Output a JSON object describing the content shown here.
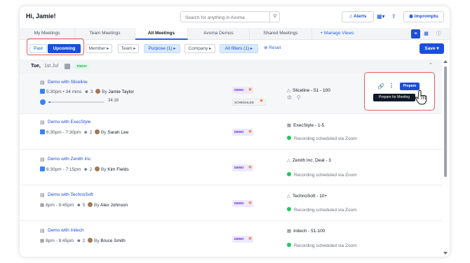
{
  "header": {
    "greeting": "Hi, Jamie!",
    "search_placeholder": "Search for anything in Avoma",
    "alerts_label": "Alerts",
    "impromptu_label": "Impromptu"
  },
  "tabs": [
    {
      "label": "My Meetings"
    },
    {
      "label": "Team Meetings"
    },
    {
      "label": "All Meetings",
      "active": true
    },
    {
      "label": "Avoma Demos"
    },
    {
      "label": "Shared Meetings"
    },
    {
      "label": "+ Manage Views"
    }
  ],
  "filters": {
    "past": "Past",
    "upcoming": "Upcoming",
    "member": "Member",
    "team": "Team",
    "purpose": "Purpose (1)",
    "company": "Company",
    "all_filters": "All filters (1)",
    "reset": "Reset",
    "save": "Save"
  },
  "date": {
    "day": "Tue,",
    "date": "1st Jul",
    "badge": "TODAY"
  },
  "meetings": [
    {
      "title": "Demo with Sliceline",
      "time": "5:30pm",
      "duration": "34 mins",
      "attendees": "3",
      "host": "Jamie Taylor",
      "progress": "34:18",
      "deal": "Sliceline - 51 - 100",
      "tag": "DEMO",
      "sched": "SCHEDULED"
    },
    {
      "title": "Demo with ExecStyle",
      "time": "6:30pm - 7:30pm",
      "attendees": "2",
      "host": "Sarah Lee",
      "deal": "ExecStyle - 1-5",
      "status": "Recording scheduled via Zoom",
      "tag": "DEMO"
    },
    {
      "title": "Demo with Zenith Inc.",
      "time": "6:30pm - 7:15pm",
      "attendees": "2",
      "host": "Kim Fields",
      "deal": "Zenith Inc. Deal - 3",
      "status": "Recording scheduled via Zoom",
      "tag": "DEMO"
    },
    {
      "title": "Demo with TechnoSoft",
      "time": "8pm - 8:45pm",
      "attendees": "5",
      "host": "Alex Johnson",
      "deal": "TechnoSoft - 10+",
      "status": "Recording scheduled via Zoom",
      "tag": "DEMO"
    },
    {
      "title": "Demo with Initech",
      "time": "8pm - 8:45pm",
      "attendees": "2",
      "host": "Bruce Smith",
      "deal": "Initech - 51-100",
      "status": "Recording scheduled via Zoom",
      "tag": "DEMO"
    }
  ],
  "prepare": {
    "button": "Prepare",
    "tooltip": "Prepare for Meeting"
  },
  "by_prefix": "By",
  "colors": {
    "accent": "#1d4ed8",
    "highlight": "#e35d5d",
    "demo_tag": "#ede9fe"
  }
}
